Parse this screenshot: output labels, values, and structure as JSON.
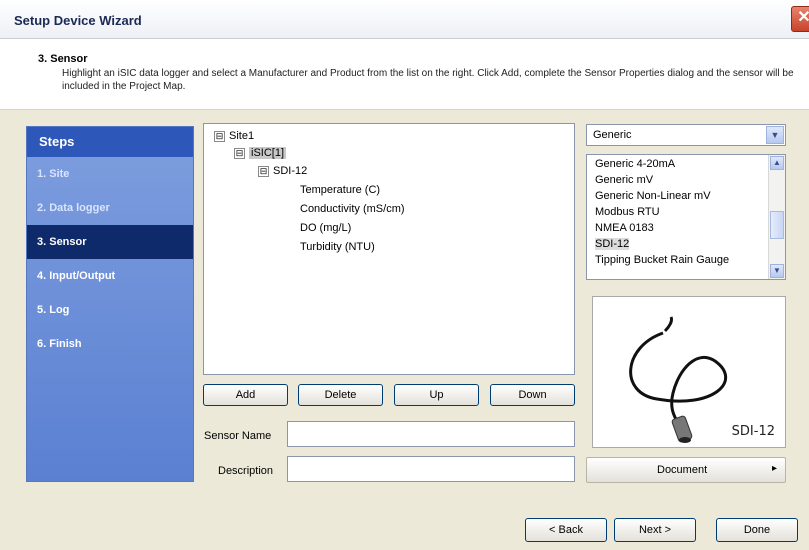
{
  "window": {
    "title": "Setup Device Wizard",
    "close_glyph": "✕"
  },
  "header": {
    "heading": "3. Sensor",
    "description": "Highlight an iSIC data logger and select a Manufacturer and Product from the list on the right. Click Add, complete the Sensor Properties dialog and the sensor will be included in the Project Map."
  },
  "steps": {
    "title": "Steps",
    "items": [
      {
        "label": "1. Site"
      },
      {
        "label": "2. Data logger"
      },
      {
        "label": "3. Sensor"
      },
      {
        "label": "4. Input/Output"
      },
      {
        "label": "5. Log"
      },
      {
        "label": "6. Finish"
      }
    ],
    "active_index": 2
  },
  "tree": {
    "items": [
      {
        "label": "Site1",
        "expander": "⊟"
      },
      {
        "label": "iSIC[1]",
        "expander": "⊟"
      },
      {
        "label": "SDI-12",
        "expander": "⊟"
      },
      {
        "label": "Temperature (C)"
      },
      {
        "label": "Conductivity (mS/cm)"
      },
      {
        "label": "DO (mg/L)"
      },
      {
        "label": "Turbidity (NTU)"
      }
    ]
  },
  "buttons": {
    "add": "Add",
    "delete": "Delete",
    "up": "Up",
    "down": "Down",
    "back": "< Back",
    "next": "Next >",
    "done": "Done"
  },
  "form": {
    "sensor_name_label": "Sensor Name",
    "sensor_name_value": "",
    "description_label": "Description",
    "description_value": ""
  },
  "manufacturer": {
    "selected": "Generic",
    "arrow_icon": "chevron-down-icon"
  },
  "products": {
    "items": [
      "Generic 4-20mA",
      "Generic mV",
      "Generic Non-Linear mV",
      "Modbus RTU",
      "NMEA 0183",
      "SDI-12",
      "Tipping Bucket Rain Gauge"
    ],
    "selected": "SDI-12"
  },
  "preview": {
    "label": "SDI-12"
  },
  "document": {
    "label": "Document",
    "arrow": "▸"
  },
  "colors": {
    "accent": "#2d57b9",
    "active_step": "#0e2a6b",
    "panel_bg": "#ece9d8"
  }
}
